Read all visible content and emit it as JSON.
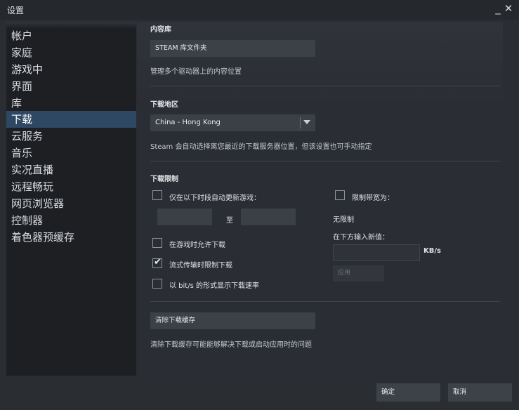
{
  "window": {
    "title": "设置",
    "minimize_label": "_",
    "close_label": "✕"
  },
  "sidebar": {
    "items": [
      {
        "label": "帐户",
        "active": false
      },
      {
        "label": "家庭",
        "active": false
      },
      {
        "label": "游戏中",
        "active": false
      },
      {
        "label": "界面",
        "active": false
      },
      {
        "label": "库",
        "active": false
      },
      {
        "label": "下载",
        "active": true
      },
      {
        "label": "云服务",
        "active": false
      },
      {
        "label": "音乐",
        "active": false
      },
      {
        "label": "实况直播",
        "active": false
      },
      {
        "label": "远程畅玩",
        "active": false
      },
      {
        "label": "网页浏览器",
        "active": false
      },
      {
        "label": "控制器",
        "active": false
      },
      {
        "label": "着色器预缓存",
        "active": false
      }
    ]
  },
  "content_library": {
    "heading": "内容库",
    "button_label": "STEAM 库文件夹",
    "description": "管理多个驱动器上的内容位置"
  },
  "download_region": {
    "heading": "下载地区",
    "selected": "China - Hong Kong",
    "description": "Steam 会自动选择离您最近的下载服务器位置，但该设置也可手动指定"
  },
  "download_limits": {
    "heading": "下载限制",
    "schedule_label": "仅在以下时段自动更新游戏：",
    "schedule_checked": false,
    "to_label": "至",
    "allow_ingame_label": "在游戏时允许下载",
    "allow_ingame_checked": false,
    "throttle_streaming_label": "流式传输时限制下载",
    "throttle_streaming_checked": true,
    "bits_label": "以 bit/s 的形式显示下载速率",
    "bits_checked": false,
    "bandwidth_label": "限制带宽为：",
    "bandwidth_checked": false,
    "current_limit": "无限制",
    "enter_new_label": "在下方输入新值：",
    "unit": "KB/s",
    "apply_label": "应用"
  },
  "cache": {
    "button_label": "清除下载缓存",
    "description": "清除下载缓存可能能够解决下载或启动应用时的问题"
  },
  "footer": {
    "ok_label": "确定",
    "cancel_label": "取消"
  },
  "colors": {
    "active_nav": "#2e4763",
    "sidebar_bg": "#1d1f23",
    "button_bg": "#3c4048"
  }
}
